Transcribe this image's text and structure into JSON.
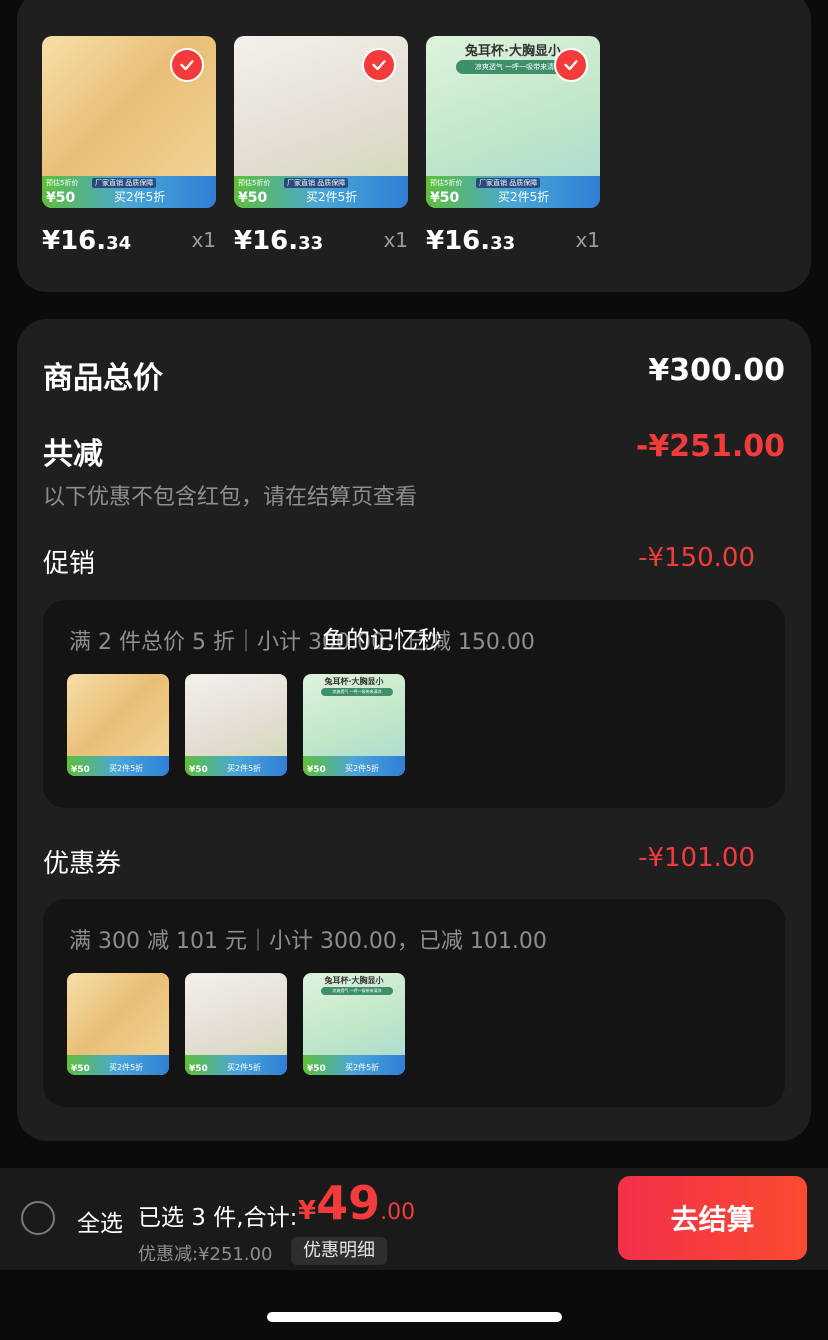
{
  "products": [
    {
      "price_int": "¥16.",
      "price_dec": "34",
      "qty": "x1",
      "scene": "scene-yellow",
      "promo_left": "预估5折价",
      "promo_price": "¥50",
      "promo_mid": "厂家直销 品质保障",
      "promo_buy": "买2件5折",
      "head": "",
      "sub": ""
    },
    {
      "price_int": "¥16.",
      "price_dec": "33",
      "qty": "x1",
      "scene": "scene-woman",
      "promo_left": "预估5折价",
      "promo_price": "¥50",
      "promo_mid": "厂家直销 品质保障",
      "promo_buy": "买2件5折",
      "head": "",
      "sub": ""
    },
    {
      "price_int": "¥16.",
      "price_dec": "33",
      "qty": "x1",
      "scene": "scene-green",
      "promo_left": "预估5折价",
      "promo_price": "¥50",
      "promo_mid": "厂家直销 品质保障",
      "promo_buy": "买2件5折",
      "head": "兔耳杯·大胸显小",
      "sub": "凉爽透气 一呼一吸带来清凉"
    }
  ],
  "summary": {
    "total_label": "商品总价",
    "total_value": "¥300.00",
    "reduce_label": "共减",
    "reduce_value": "-¥251.00",
    "reduce_hint": "以下优惠不包含红包，请在结算页查看",
    "promo_label": "促销",
    "promo_value": "-¥150.00",
    "promo_detail": "满 2 件总价 5 折｜小计 300.00，已减 150.00",
    "coupon_label": "优惠券",
    "coupon_value": "-¥101.00",
    "coupon_detail": "满 300 减 101 元｜小计 300.00，已减 101.00"
  },
  "overlay_text": "鱼的记忆秒",
  "bottom_bar": {
    "select_all_label": "全选",
    "selected_text": "已选 3 件,合计:",
    "total_currency": "¥",
    "total_int": "49",
    "total_dec": ".00",
    "discount_text": "优惠减:¥251.00",
    "detail_label": "优惠明细",
    "checkout_label": "去结算"
  },
  "colors": {
    "accent_red": "#f43b3b",
    "card_bg": "#1f1f1f",
    "page_bg": "#0b0b0b"
  }
}
